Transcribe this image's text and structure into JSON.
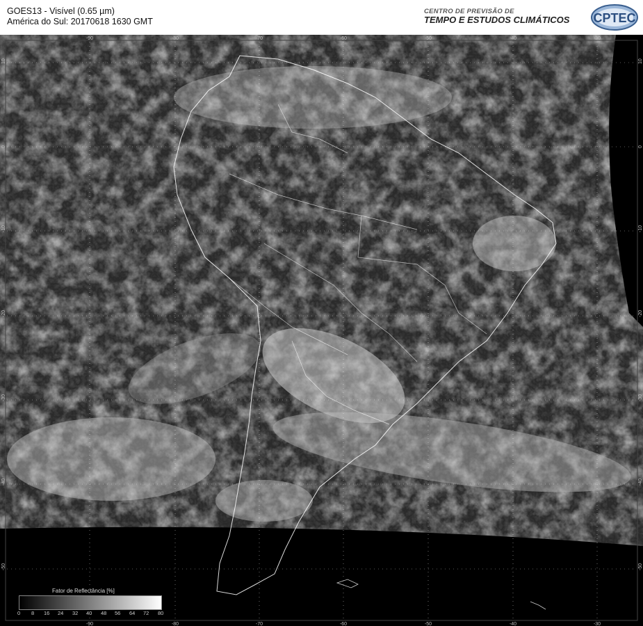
{
  "header": {
    "line1": "GOES13 - Visível (0.65 µm)",
    "line2": "América do Sul: 20170618 1630 GMT",
    "org_line1": "CENTRO DE PREVISÃO DE",
    "org_line2": "TEMPO E ESTUDOS CLIMÁTICOS",
    "logo_text": "CPTEC"
  },
  "map": {
    "longitude_labels": [
      "-90",
      "-80",
      "-70",
      "-60",
      "-50",
      "-40",
      "-30"
    ],
    "latitude_labels": [
      "10",
      "0",
      "-10",
      "-20",
      "-30",
      "-40",
      "-50"
    ]
  },
  "legend": {
    "title": "Fator de Reflectância [%]",
    "ticks": [
      "0",
      "8",
      "16",
      "24",
      "32",
      "40",
      "48",
      "56",
      "64",
      "72",
      "80"
    ]
  },
  "colors": {
    "background": "#000000",
    "coastline": "#ffffff",
    "grid": "#ffffff"
  }
}
